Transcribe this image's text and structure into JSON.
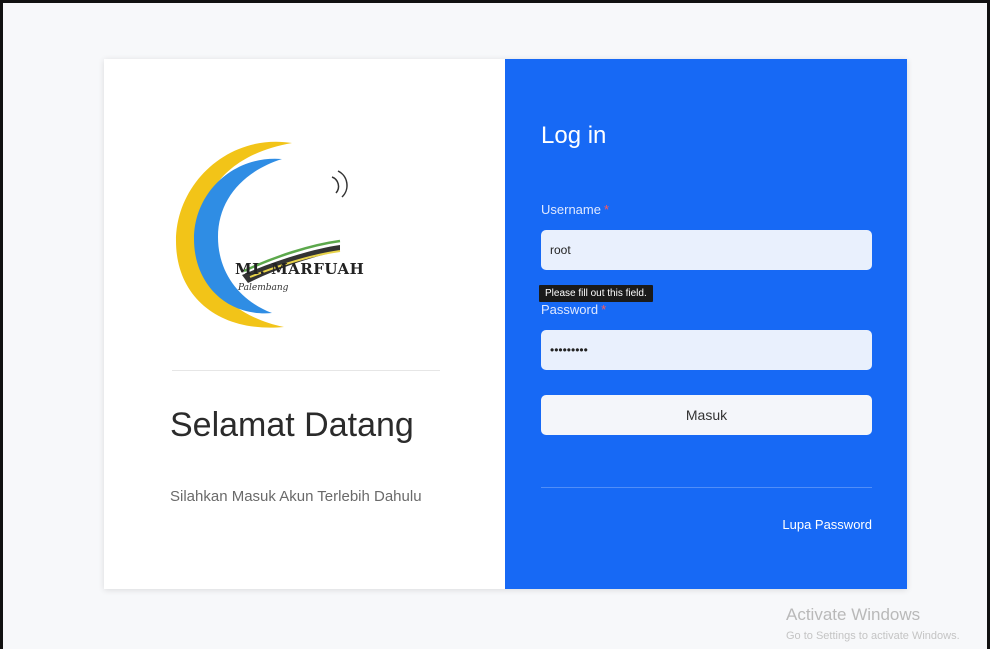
{
  "left_panel": {
    "logo_text": "MI. MARFUAH",
    "logo_subtext": "Palembang",
    "heading": "Selamat Datang",
    "subheading": "Silahkan Masuk Akun Terlebih Dahulu"
  },
  "login": {
    "title": "Log in",
    "username_label": "Username",
    "required_mark": "*",
    "username_value": "root",
    "tooltip": "Please fill out this field.",
    "password_label": "Password",
    "password_value": "passwords",
    "submit_label": "Masuk",
    "forgot_label": "Lupa Password"
  },
  "watermark": {
    "title": "Activate Windows",
    "subtitle": "Go to Settings to activate Windows."
  },
  "colors": {
    "panel_blue": "#1769f5",
    "logo_blue": "#2f8de4",
    "logo_yellow": "#f2c418"
  }
}
